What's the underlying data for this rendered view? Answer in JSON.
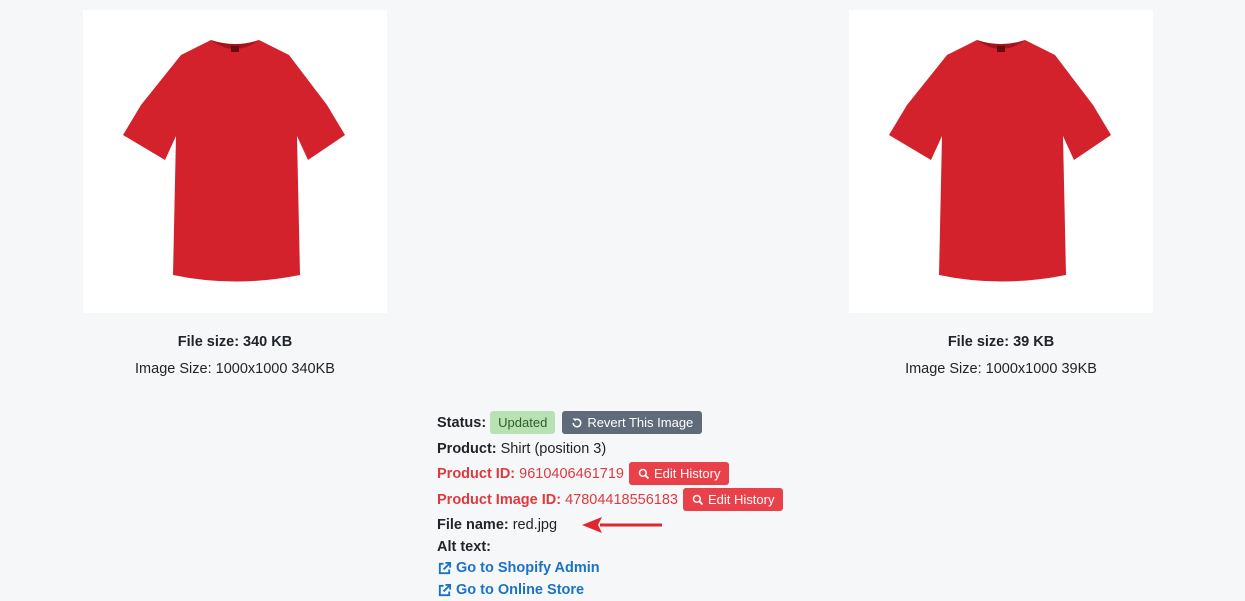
{
  "left": {
    "file_size": "File size: 340 KB",
    "image_size": "Image Size: 1000x1000 340KB"
  },
  "right": {
    "file_size": "File size: 39 KB",
    "image_size": "Image Size: 1000x1000 39KB"
  },
  "details": {
    "status_label": "Status:",
    "status_badge": "Updated",
    "revert_button": "Revert This Image",
    "product_label": "Product:",
    "product_value": "Shirt (position 3)",
    "product_id_label": "Product ID:",
    "product_id_value": "9610406461719",
    "product_image_id_label": "Product Image ID:",
    "product_image_id_value": "47804418556183",
    "edit_history": "Edit History",
    "file_name_label": "File name:",
    "file_name_value": "red.jpg",
    "alt_text_label": "Alt text:",
    "shopify_admin_link": "Go to Shopify Admin",
    "online_store_link": "Go to Online Store"
  },
  "colors": {
    "shirt": "#d3222b",
    "accent_red": "#e8414a",
    "badge_green": "#b9e2b4",
    "link_blue": "#1a73c6",
    "button_gray": "#5f6b79"
  },
  "icons": [
    "undo-icon",
    "search-icon",
    "external-link-icon",
    "red-arrow"
  ]
}
